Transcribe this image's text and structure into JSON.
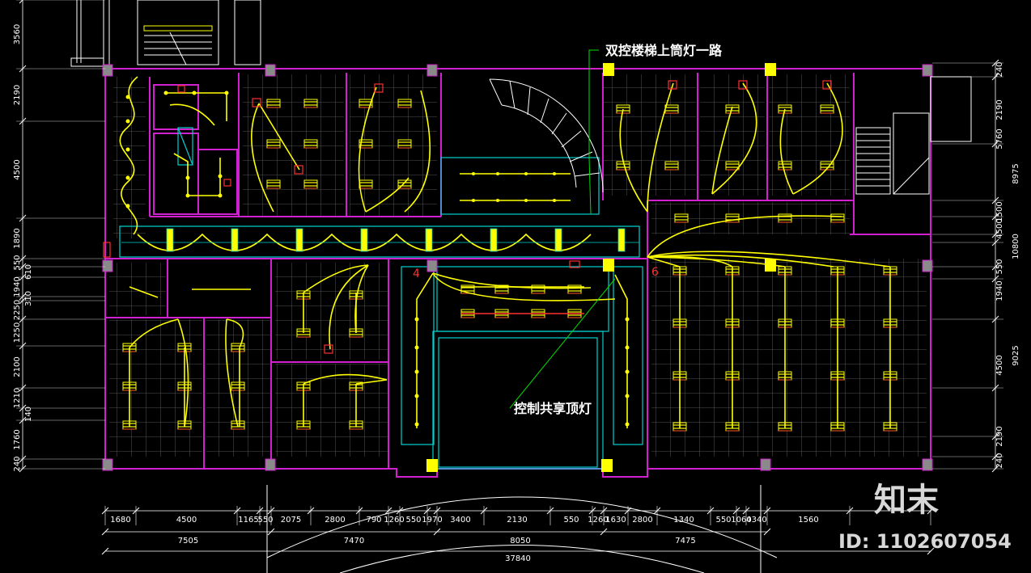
{
  "annotations": {
    "stair_note": "双控楼梯上筒灯一路",
    "atrium_note": "控制共享顶灯"
  },
  "markers": {
    "m4": "4",
    "m6": "6"
  },
  "dims_bottom_row1": [
    "1680",
    "4500",
    "1165",
    "550",
    "2075",
    "2800",
    "790",
    "1260",
    "550",
    "1970",
    "3400",
    "2130",
    "550",
    "1260",
    "1630",
    "2800",
    "1340",
    "550",
    "1060",
    "4340",
    "1560"
  ],
  "dims_bottom_row2": [
    "7505",
    "7470",
    "8050",
    "7475"
  ],
  "dims_bottom_total": "37840",
  "dims_left": [
    "3560",
    "2190",
    "4500",
    "1890",
    "550",
    "610",
    "1940",
    "310",
    "2250",
    "1250",
    "2100",
    "1210",
    "140",
    "1760",
    "240"
  ],
  "dims_right": [
    "240",
    "2190",
    "5760",
    "4500",
    "8975",
    "1500",
    "240",
    "10800",
    "550",
    "1940",
    "4500",
    "9025",
    "2190",
    "240"
  ],
  "watermark": {
    "brand": "知末",
    "id": "ID: 1102607054"
  },
  "colors": {
    "wall": "#d020d0",
    "light": "#ffff00",
    "grid": "#909090",
    "dimension": "#ffffff",
    "cyan": "#00d0d0",
    "leader": "#00e000"
  }
}
